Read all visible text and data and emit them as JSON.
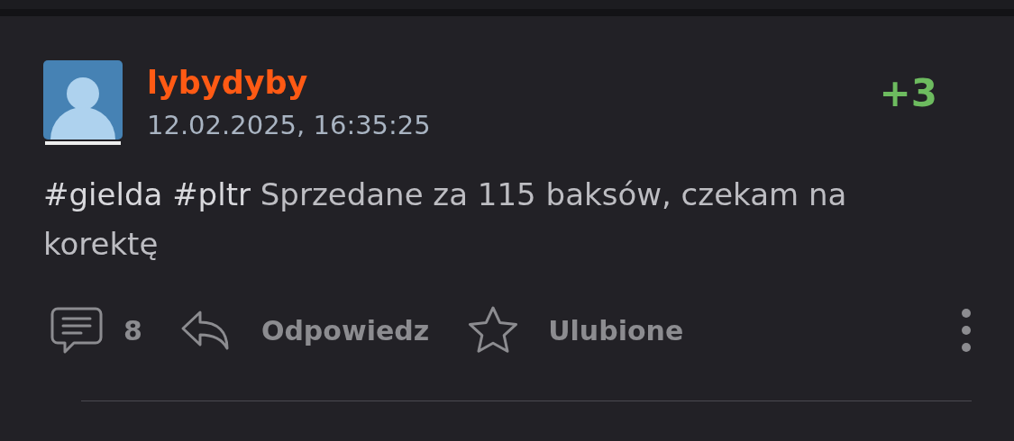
{
  "post": {
    "author": "lybydyby",
    "timestamp": "12.02.2025, 16:35:25",
    "score": "+3",
    "tags": [
      "#gielda",
      "#pltr"
    ],
    "body": "Sprzedane za 115 baksów, czekam na korektę"
  },
  "actions": {
    "comment_count": "8",
    "reply": "Odpowiedz",
    "favorite": "Ulubione"
  }
}
